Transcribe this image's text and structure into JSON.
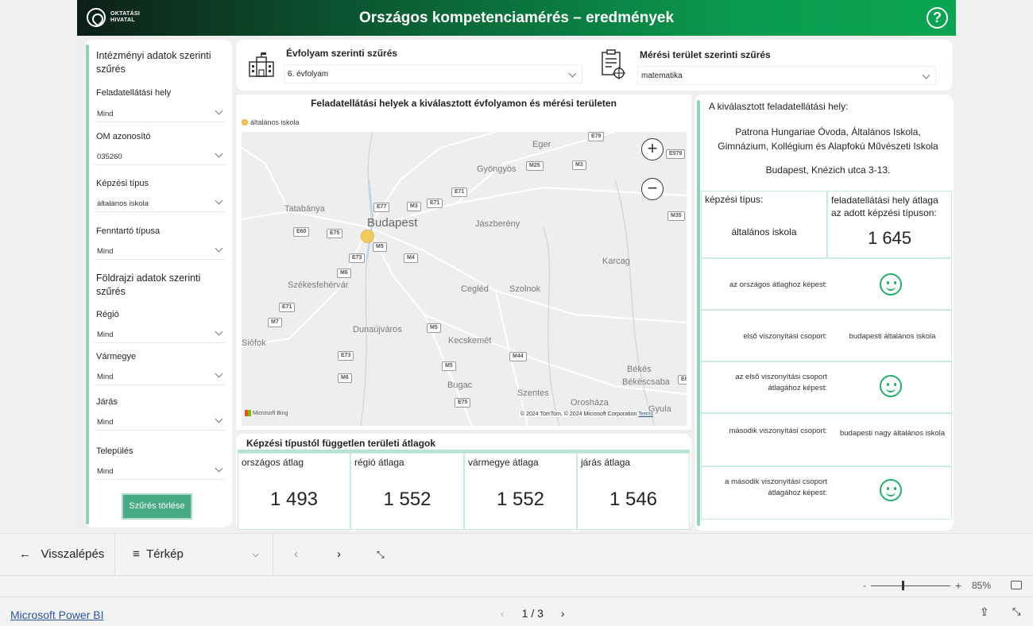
{
  "header": {
    "title": "Országos kompetenciamérés – eredmények",
    "logo_line1": "OKTATÁSI",
    "logo_line2": "HIVATAL",
    "help_icon": "question-circle-icon"
  },
  "left": {
    "heading1": "Intézményi adatok szerinti szűrés",
    "filters1": [
      {
        "label": "Feladatellátási hely",
        "value": "Mind"
      },
      {
        "label": "OM azonosító",
        "value": "035260"
      },
      {
        "label": "Képzési típus",
        "value": "általános iskola"
      },
      {
        "label": "Fenntartó típusa",
        "value": "Mind"
      }
    ],
    "heading2": "Földrajzi adatok szerinti szűrés",
    "filters2": [
      {
        "label": "Régió",
        "value": "Mind"
      },
      {
        "label": "Vármegye",
        "value": "Mind"
      },
      {
        "label": "Járás",
        "value": "Mind"
      },
      {
        "label": "Település",
        "value": "Mind"
      }
    ],
    "clear_button": "Szűrés törlése"
  },
  "filterbar": {
    "grade_label": "Évfolyam szerinti szűrés",
    "grade_value": "6. évfolyam",
    "area_label": "Mérési terület szerinti szűrés",
    "area_value": "matematika",
    "school_icon": "school-building-icon",
    "test_icon": "test-sheet-icon"
  },
  "map": {
    "title": "Feladatellátási helyek a kiválasztott évfolyamon és mérési területen",
    "legend": "általános iskola",
    "cities": [
      "Eger",
      "Gyöngyös",
      "Tatabánya",
      "Budapest",
      "Jászberény",
      "Karcag",
      "Székesfehérvár",
      "Cegléd",
      "Szolnok",
      "Dunaújváros",
      "Siófok",
      "Kecskemét",
      "Békés",
      "Békéscsaba",
      "Bugac",
      "Szentes",
      "Orosháza",
      "Gyula"
    ],
    "roads": [
      "E79",
      "E579",
      "M25",
      "M3",
      "E71",
      "M35",
      "E77",
      "M3",
      "E71",
      "E60",
      "E75",
      "M5",
      "E73",
      "M4",
      "M6",
      "E71",
      "M7",
      "M5",
      "E73",
      "M44",
      "M5",
      "M6",
      "E75",
      "E6"
    ],
    "attribution": "© 2024 TomTom, © 2024 Microsoft Corporation",
    "terms": "Terms",
    "bing": "Microsoft Bing",
    "marker_color": "#f2c94c"
  },
  "averages": {
    "title": "Képzési típustól független területi átlagok",
    "cells": [
      {
        "label": "országos átlag",
        "value": "1 493"
      },
      {
        "label": "régió átlaga",
        "value": "1 552"
      },
      {
        "label": "vármegye átlaga",
        "value": "1 552"
      },
      {
        "label": "járás átlaga",
        "value": "1 546"
      }
    ]
  },
  "selected": {
    "heading": "A kiválasztott feladatellátási hely:",
    "name": "Patrona Hungariae Óvoda, Általános Iskola, Gimnázium, Kollégium és Alapfokú Művészeti Iskola",
    "address": "Budapest, Knézich utca 3-13.",
    "type_label": "képzési típus:",
    "type_value": "általános iskola",
    "avg_label": "feladatellátási hely átlaga az adott képzési típuson:",
    "avg_value": "1 645",
    "rows": [
      {
        "label": "az országos átlaghoz képest:",
        "value": "",
        "icon": "smiley-icon"
      },
      {
        "label": "első viszonyítási csoport:",
        "value": "budapesti általános iskola",
        "icon": ""
      },
      {
        "label": "az első viszonyítási csoport átlagához képest:",
        "value": "",
        "icon": "smiley-icon"
      },
      {
        "label": "második viszonyítási csoport:",
        "value": "budapesti nagy általános iskola",
        "icon": ""
      },
      {
        "label": "a második viszonyítási csoport átlagához képest:",
        "value": "",
        "icon": "smiley-icon"
      }
    ],
    "accent": "#1eb26b"
  },
  "nav": {
    "back": "Visszalépés",
    "page": "Térkép",
    "zoom": "85%"
  },
  "footer": {
    "brand": "Microsoft Power BI",
    "pages": "1 / 3"
  }
}
